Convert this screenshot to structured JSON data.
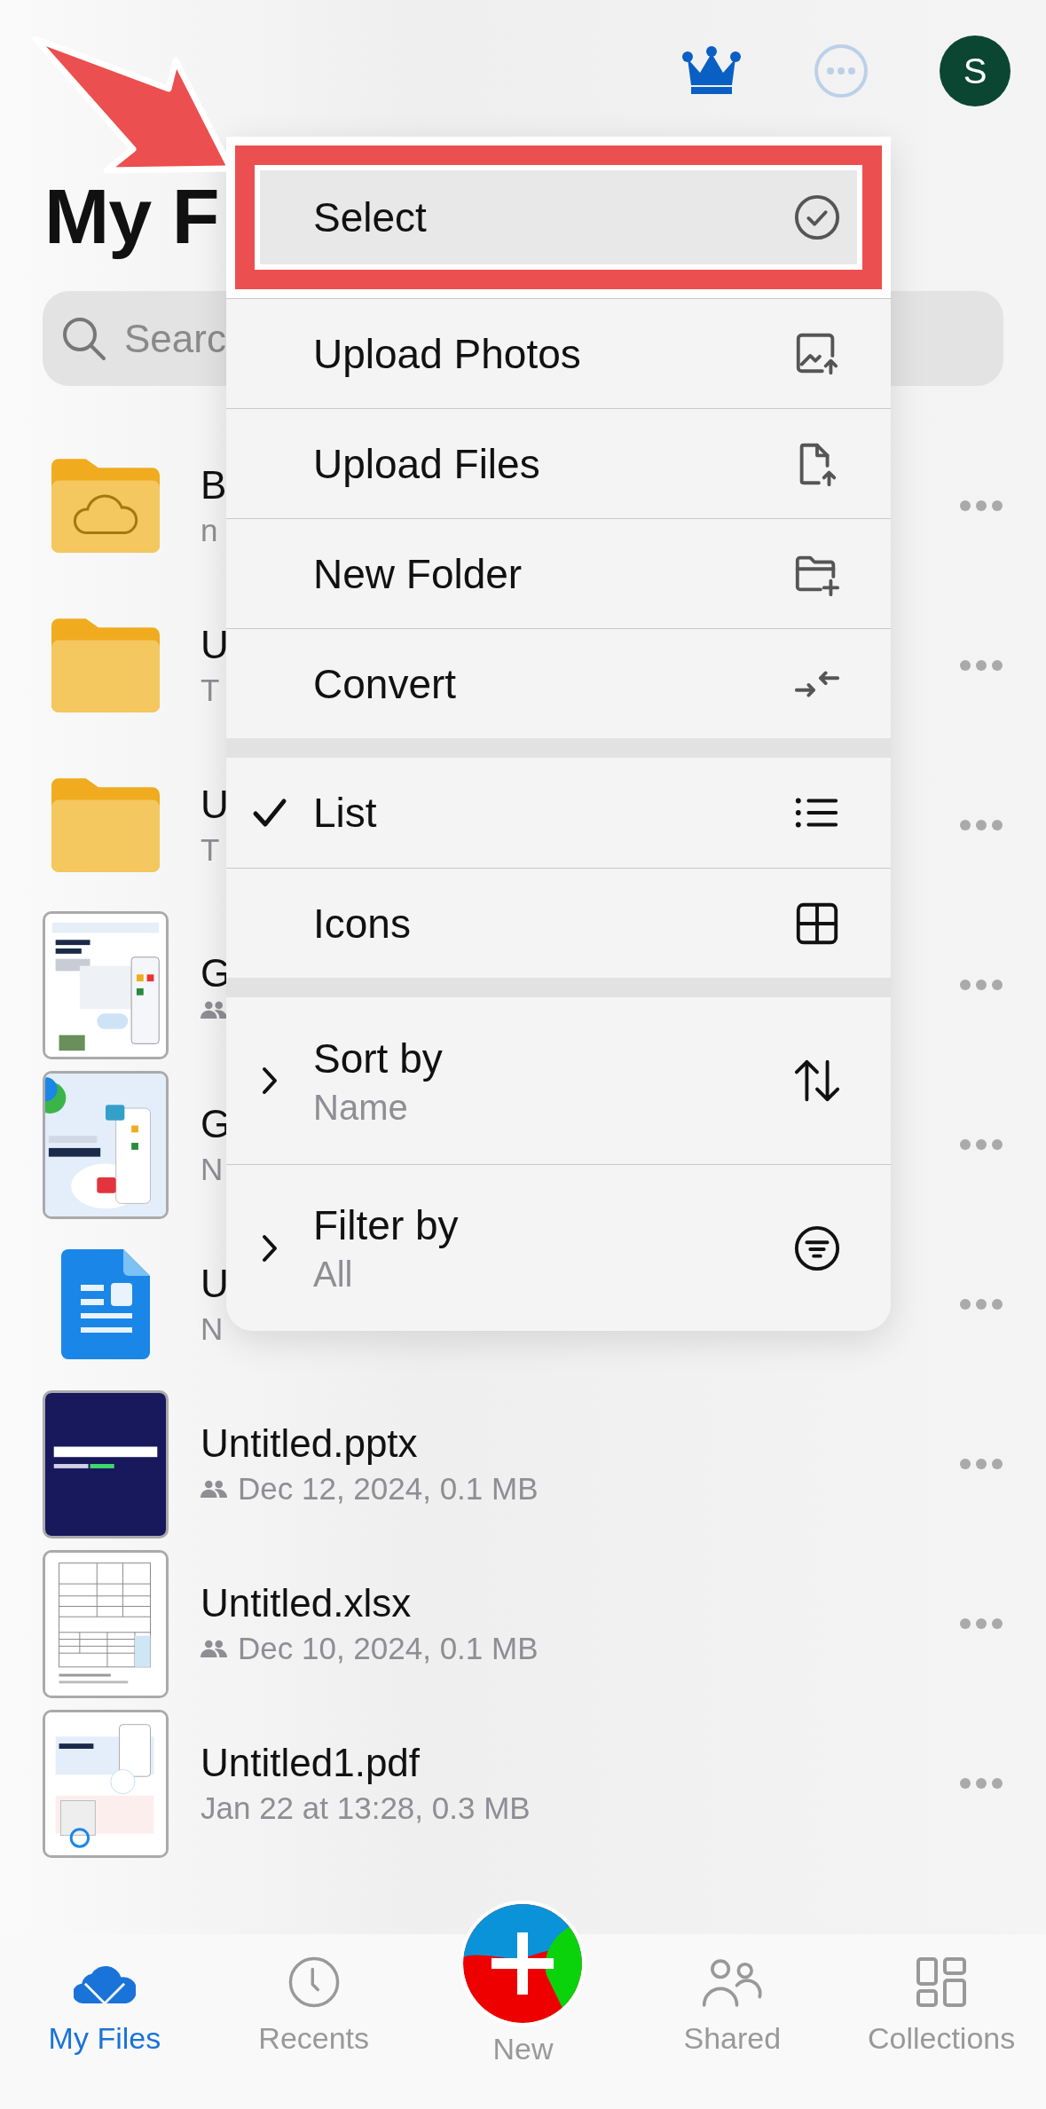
{
  "header": {
    "avatar": "S"
  },
  "title": "My F",
  "search": {
    "placeholder": "Searc"
  },
  "files": [
    {
      "kind": "cloud-folder",
      "name": "B",
      "detail": "n",
      "shared": false
    },
    {
      "kind": "folder",
      "name": "U",
      "detail": "T",
      "shared": false
    },
    {
      "kind": "folder",
      "name": "U",
      "detail": "T",
      "shared": false
    },
    {
      "kind": "flyer",
      "name": "G",
      "shared": true
    },
    {
      "kind": "promo",
      "name": "G",
      "detail": "N",
      "shared": false
    },
    {
      "kind": "document",
      "name": "U",
      "detail": "N",
      "shared": false
    },
    {
      "kind": "slides",
      "name": "Untitled.pptx",
      "detail": "Dec 12, 2024, 0.1 MB",
      "shared": true
    },
    {
      "kind": "sheet",
      "name": "Untitled.xlsx",
      "detail": "Dec 10, 2024, 0.1 MB",
      "shared": true
    },
    {
      "kind": "pdf",
      "name": "Untitled1.pdf",
      "detail": "Jan 22 at 13:28, 0.3 MB",
      "shared": false
    }
  ],
  "menu": {
    "sections": [
      {
        "items": [
          {
            "kind": "action",
            "label": "Select",
            "highlighted": true
          },
          {
            "kind": "action",
            "label": "Upload Photos",
            "highlighted": false
          },
          {
            "kind": "action",
            "label": "Upload Files",
            "highlighted": false
          },
          {
            "kind": "action",
            "label": "New Folder",
            "highlighted": false
          },
          {
            "kind": "action",
            "label": "Convert",
            "highlighted": false
          }
        ]
      },
      {
        "items": [
          {
            "kind": "option",
            "label": "List",
            "checked": true
          },
          {
            "kind": "option",
            "label": "Icons",
            "checked": false
          }
        ]
      },
      {
        "items": [
          {
            "kind": "submenu",
            "label": "Sort by",
            "value": "Name"
          },
          {
            "kind": "submenu",
            "label": "Filter by",
            "value": "All"
          }
        ]
      }
    ]
  },
  "tabs": [
    {
      "kind": "tab",
      "label": "My Files",
      "selected": true
    },
    {
      "kind": "tab",
      "label": "Recents",
      "selected": false
    },
    {
      "kind": "action",
      "label": "New",
      "selected": false
    },
    {
      "kind": "tab",
      "label": "Shared",
      "selected": false
    },
    {
      "kind": "tab",
      "label": "Collections",
      "selected": false
    }
  ]
}
